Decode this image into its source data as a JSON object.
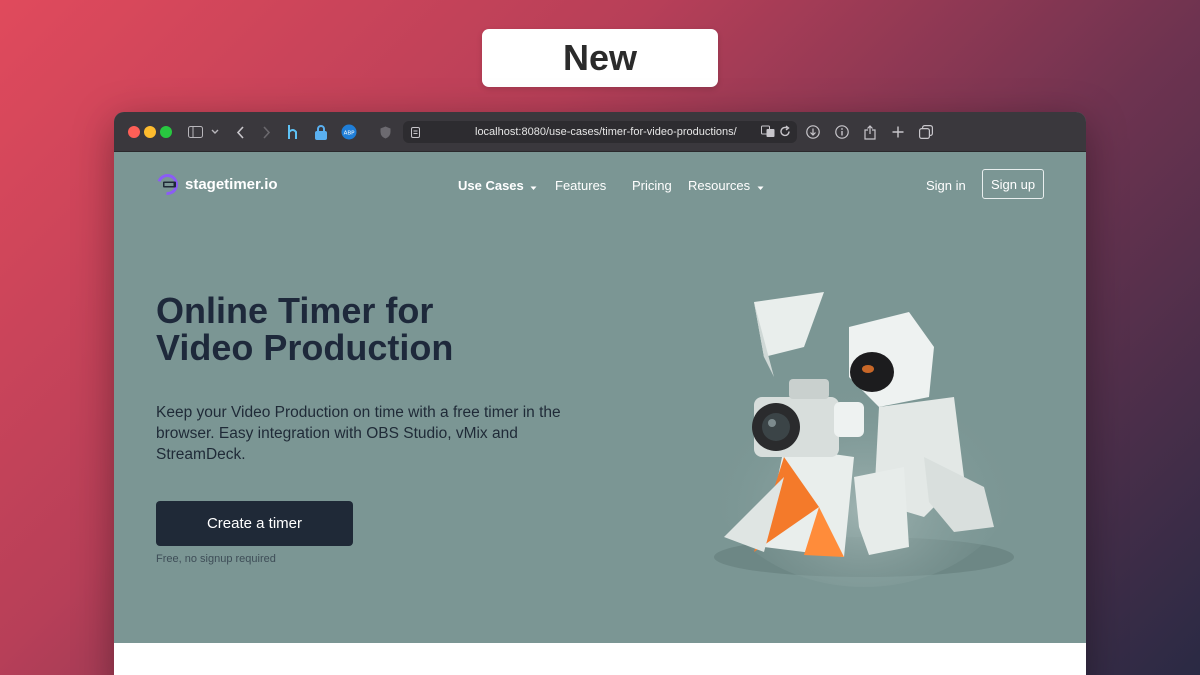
{
  "badge": {
    "label": "New"
  },
  "browser": {
    "url": "localhost:8080/use-cases/timer-for-video-productions/",
    "extension_badge": "ABP"
  },
  "site": {
    "logo_text": "stagetimer.io",
    "nav": {
      "items": [
        {
          "label": "Use Cases",
          "has_dropdown": true
        },
        {
          "label": "Features",
          "has_dropdown": false
        },
        {
          "label": "Pricing",
          "has_dropdown": false
        },
        {
          "label": "Resources",
          "has_dropdown": true
        }
      ],
      "sign_in": "Sign in",
      "sign_up": "Sign up"
    },
    "hero": {
      "title_line1": "Online Timer for",
      "title_line2": "Video Production",
      "subtitle": "Keep your Video Production on time with a free timer in the browser. Easy integration with OBS Studio, vMix and StreamDeck.",
      "cta": "Create a timer",
      "cta_note": "Free, no signup required"
    }
  },
  "colors": {
    "page_bg": "#7b9694",
    "cta_bg": "#1f2937",
    "accent_orange": "#f47a2a"
  },
  "icons": {
    "hero_illustration": "astronaut-camera-illustration"
  }
}
